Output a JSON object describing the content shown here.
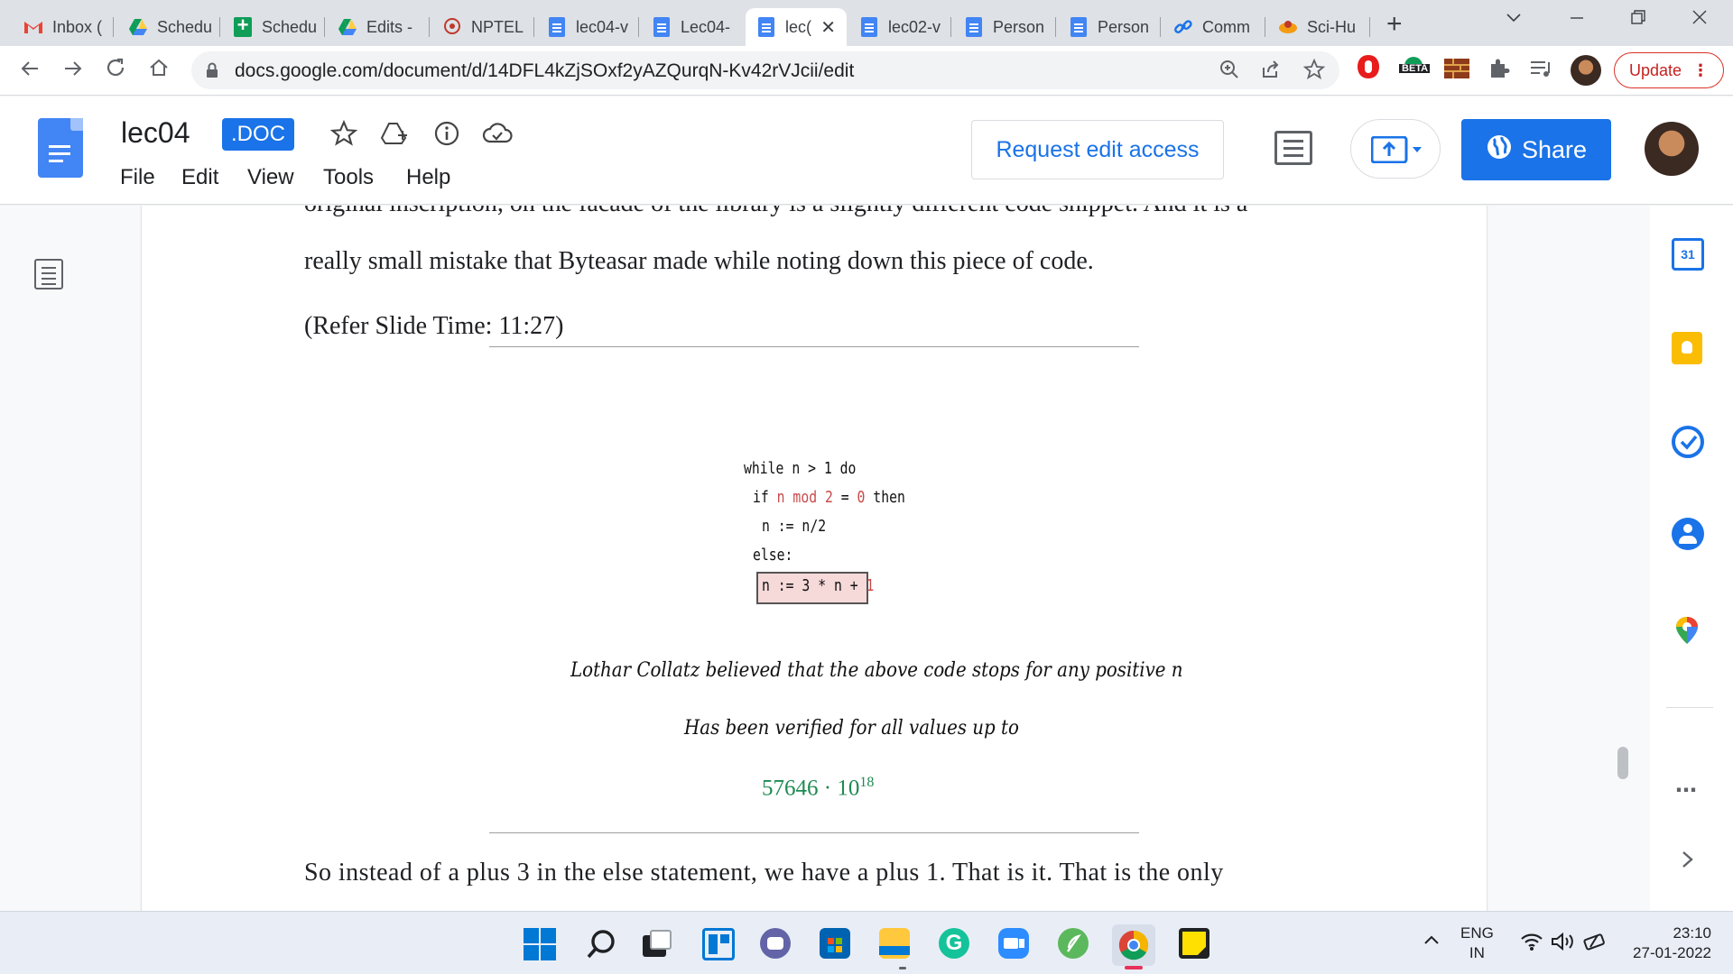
{
  "browser": {
    "tabs": [
      {
        "label": "Inbox (",
        "icon": "gmail-icon"
      },
      {
        "label": "Schedu",
        "icon": "google-drive-icon"
      },
      {
        "label": "Schedu",
        "icon": "google-sheets-icon"
      },
      {
        "label": "Edits -",
        "icon": "google-drive-icon"
      },
      {
        "label": "NPTEL",
        "icon": "nptel-icon"
      },
      {
        "label": "lec04-v",
        "icon": "google-docs-icon"
      },
      {
        "label": "Lec04-",
        "icon": "google-docs-icon"
      },
      {
        "label": "lec(",
        "icon": "google-docs-icon",
        "active": true
      },
      {
        "label": "lec02-v",
        "icon": "google-docs-icon"
      },
      {
        "label": "Person",
        "icon": "google-docs-icon"
      },
      {
        "label": "Person",
        "icon": "google-docs-icon"
      },
      {
        "label": "Comm",
        "icon": "link-icon"
      },
      {
        "label": "Sci-Hu",
        "icon": "scihub-icon"
      }
    ],
    "url": "docs.google.com/document/d/14DFL4kZjSOxf2yAZQurqN-Kv42rVJcii/edit",
    "update_label": "Update",
    "beta_label": "BETA"
  },
  "docs": {
    "title": "lec04",
    "badge": ".DOC",
    "menu": [
      "File",
      "Edit",
      "View",
      "Tools",
      "Help"
    ],
    "request_edit_label": "Request edit access",
    "share_label": "Share"
  },
  "document": {
    "partial_line": "original inscription, on the facade of the library is a slightly different code snippet. And it is a",
    "line1": "really small mistake that Byteasar made while noting down this piece of code.",
    "line2": "(Refer Slide Time: 11:27)",
    "line3": "So instead of a plus 3 in the else statement, we have a plus 1. That is it. That is the only"
  },
  "slide": {
    "code_line1": "while n > 1 do",
    "code_if": "if ",
    "code_cond": "n mod 2",
    "code_eq": " = ",
    "code_zero": "0",
    "code_then": " then",
    "code_line3": "n := n/2",
    "code_line4": "else:",
    "code_line5a": "n := 3 * n + ",
    "code_line5b": "1",
    "note1": "Lothar Collatz believed that the above code stops for any positive n",
    "note2": "Has been verified for all values up to",
    "value_base": "57646 · 10",
    "value_exp": "18"
  },
  "sidepanel": {
    "calendar_day": "31"
  },
  "taskbar": {
    "lang1": "ENG",
    "lang2": "IN",
    "time": "23:10",
    "date": "27-01-2022"
  },
  "colors": {
    "accent": "#1a73e8",
    "code_red": "#c94a4a",
    "value_green": "#1e8a52",
    "highlight_bg": "#f6d9d9"
  }
}
